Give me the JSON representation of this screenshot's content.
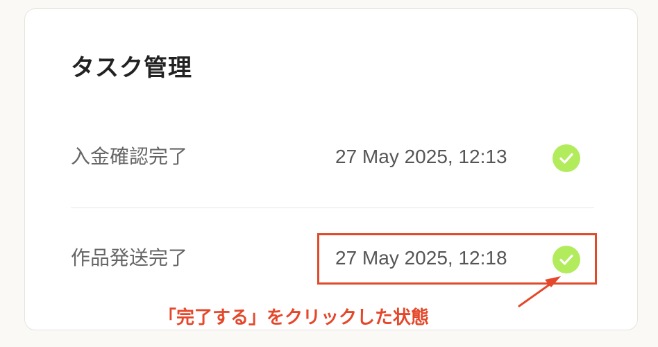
{
  "page": {
    "title": "タスク管理"
  },
  "tasks": [
    {
      "label": "入金確認完了",
      "timestamp": "27 May 2025, 12:13",
      "status_icon": "check-circle-icon"
    },
    {
      "label": "作品発送完了",
      "timestamp": "27 May 2025, 12:18",
      "status_icon": "check-circle-icon"
    }
  ],
  "annotation": {
    "text": "「完了する」をクリックした状態"
  },
  "colors": {
    "check": "#b2ec5d",
    "annotation": "#e5472a"
  }
}
